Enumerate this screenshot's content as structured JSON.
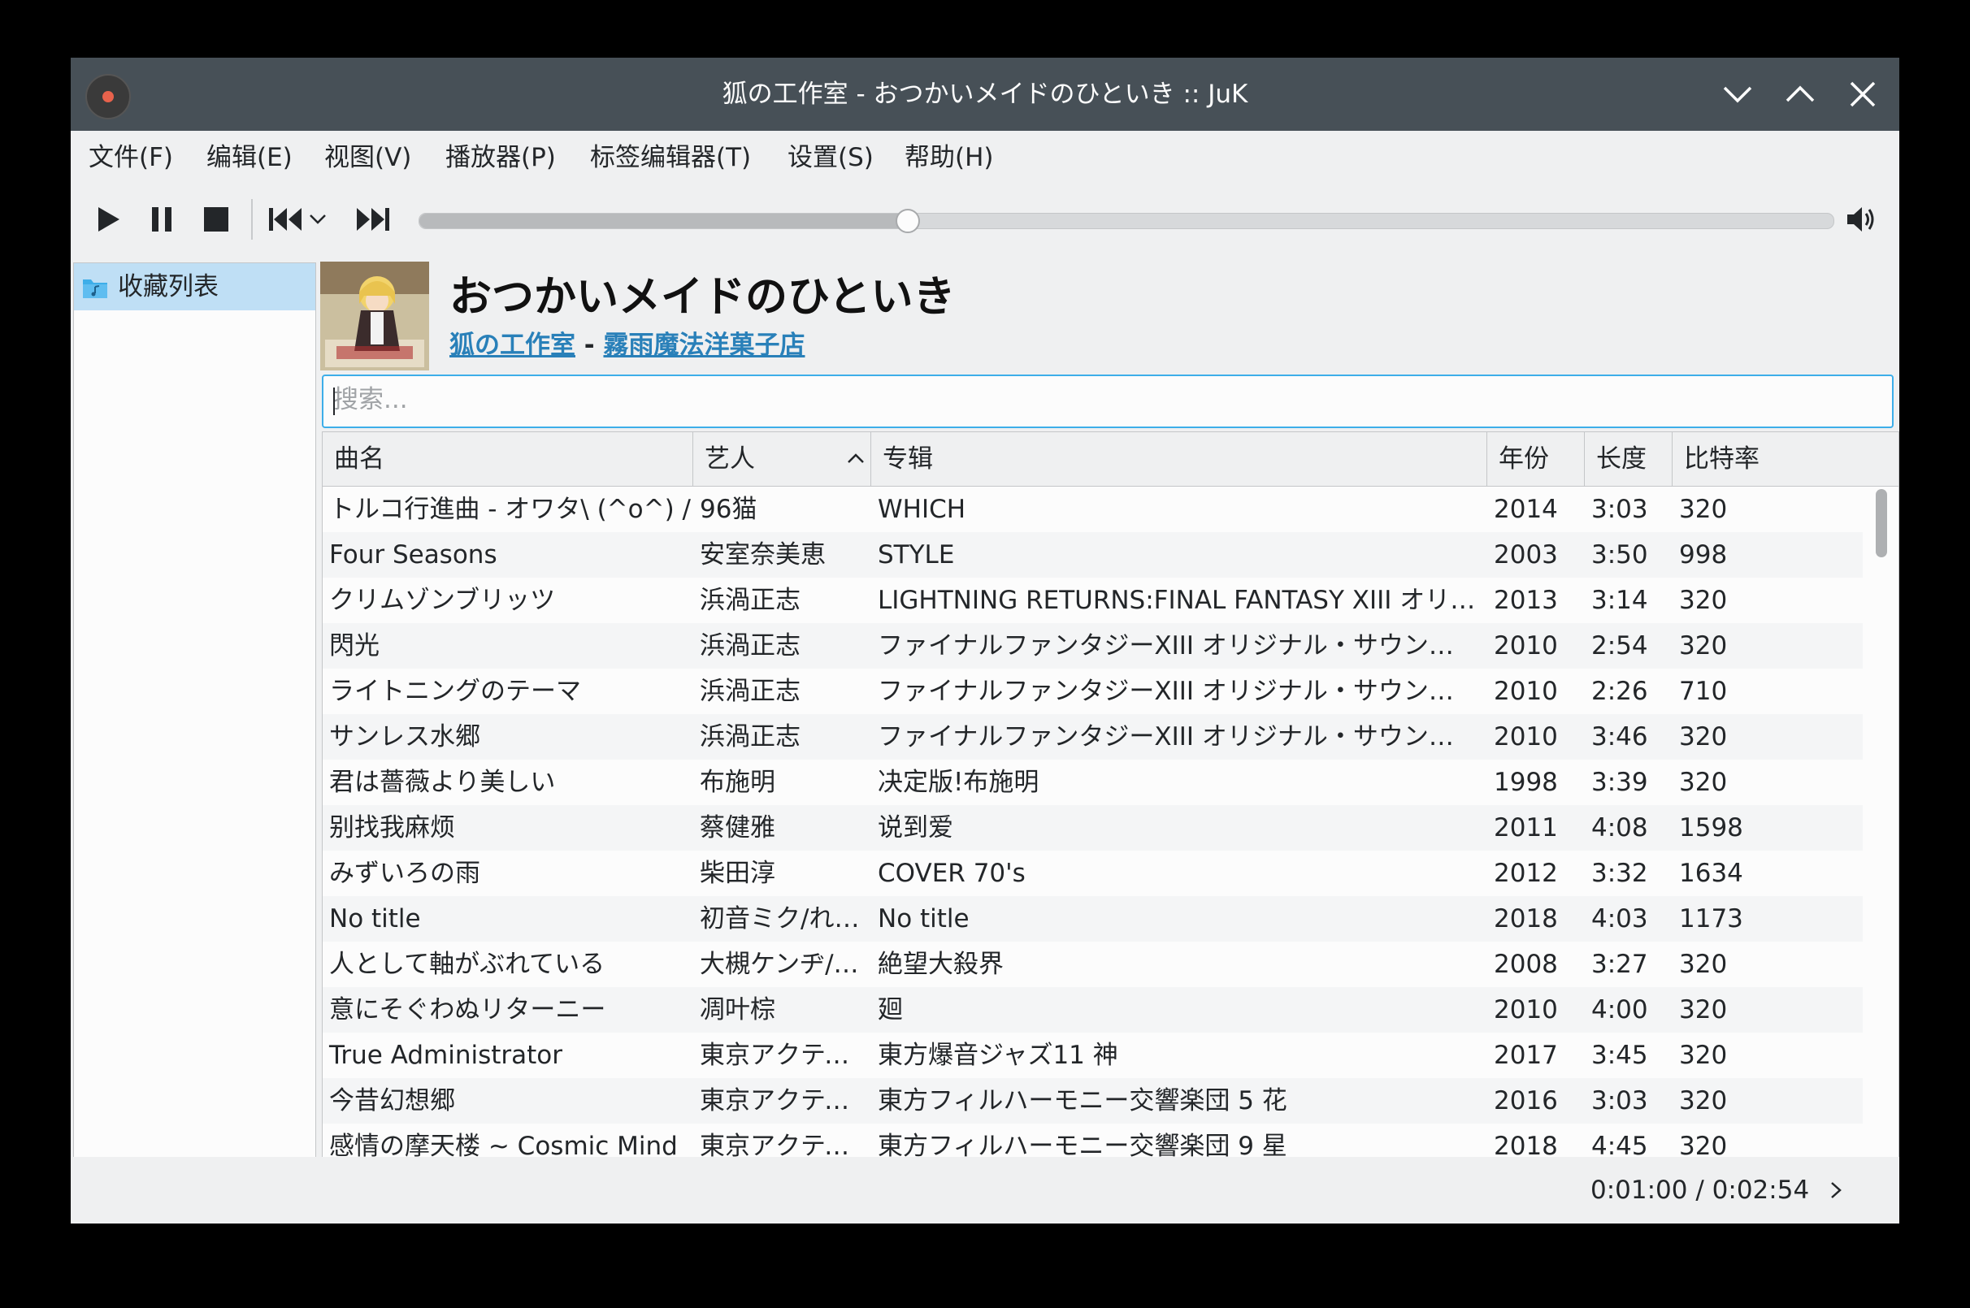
{
  "window": {
    "title": "狐の工作室 - おつかいメイドのひといき :: JuK"
  },
  "menu": [
    {
      "label": "文件(F)"
    },
    {
      "label": "编辑(E)"
    },
    {
      "label": "视图(V)"
    },
    {
      "label": "播放器(P)"
    },
    {
      "label": "标签编辑器(T)"
    },
    {
      "label": "设置(S)"
    },
    {
      "label": "帮助(H)"
    }
  ],
  "player": {
    "progress_fraction": 0.3448,
    "elapsed": "0:01:00",
    "total": "0:02:54",
    "time_display": "0:01:00 / 0:02:54"
  },
  "sidebar": {
    "items": [
      {
        "label": "收藏列表",
        "icon": "music-folder-icon"
      }
    ]
  },
  "now_playing": {
    "title": "おつかいメイドのひといき",
    "artist": "狐の工作室",
    "separator": "-",
    "album": "霧雨魔法洋菓子店"
  },
  "search": {
    "placeholder": "搜索...",
    "value": ""
  },
  "table": {
    "columns": [
      {
        "label": "曲名"
      },
      {
        "label": "艺人",
        "sorted": "ascending"
      },
      {
        "label": "专辑"
      },
      {
        "label": "年份"
      },
      {
        "label": "长度"
      },
      {
        "label": "比特率"
      }
    ],
    "rows": [
      [
        "トルコ行進曲 - オワタ\\ (^o^) /",
        "96猫",
        "WHICH",
        "2014",
        "3:03",
        "320"
      ],
      [
        "Four Seasons",
        "安室奈美恵",
        "STYLE",
        "2003",
        "3:50",
        "998"
      ],
      [
        "クリムゾンブリッツ",
        "浜渦正志",
        "LIGHTNING RETURNS:FINAL FANTASY XIII オリ…",
        "2013",
        "3:14",
        "320"
      ],
      [
        "閃光",
        "浜渦正志",
        "ファイナルファンタジーXIII オリジナル・サウン…",
        "2010",
        "2:54",
        "320"
      ],
      [
        "ライトニングのテーマ",
        "浜渦正志",
        "ファイナルファンタジーXIII オリジナル・サウン…",
        "2010",
        "2:26",
        "710"
      ],
      [
        "サンレス水郷",
        "浜渦正志",
        "ファイナルファンタジーXIII オリジナル・サウン…",
        "2010",
        "3:46",
        "320"
      ],
      [
        "君は薔薇より美しい",
        "布施明",
        "决定版!布施明",
        "1998",
        "3:39",
        "320"
      ],
      [
        "别找我麻烦",
        "蔡健雅",
        "说到爱",
        "2011",
        "4:08",
        "1598"
      ],
      [
        "みずいろの雨",
        "柴田淳",
        "COVER 70's",
        "2012",
        "3:32",
        "1634"
      ],
      [
        "No title",
        "初音ミク/れをる/Sh…",
        "No title",
        "2018",
        "4:03",
        "1173"
      ],
      [
        "人として軸がぶれている",
        "大槻ケンヂ/絶望少…",
        "絶望大殺界",
        "2008",
        "3:27",
        "320"
      ],
      [
        "意にそぐわぬリターニー",
        "凋叶棕",
        "廻",
        "2010",
        "4:00",
        "320"
      ],
      [
        "True Administrator",
        "東京アクティブNEETs",
        "東方爆音ジャズ11 神",
        "2017",
        "3:45",
        "320"
      ],
      [
        "今昔幻想郷",
        "東京アクティブNEETs",
        "東方フィルハーモニー交響楽団 5 花",
        "2016",
        "3:03",
        "320"
      ],
      [
        "感情の摩天楼 ~ Cosmic Mind",
        "東京アクティブNEETs",
        "東方フィルハーモニー交響楽団 9 星",
        "2018",
        "4:45",
        "320"
      ]
    ]
  }
}
